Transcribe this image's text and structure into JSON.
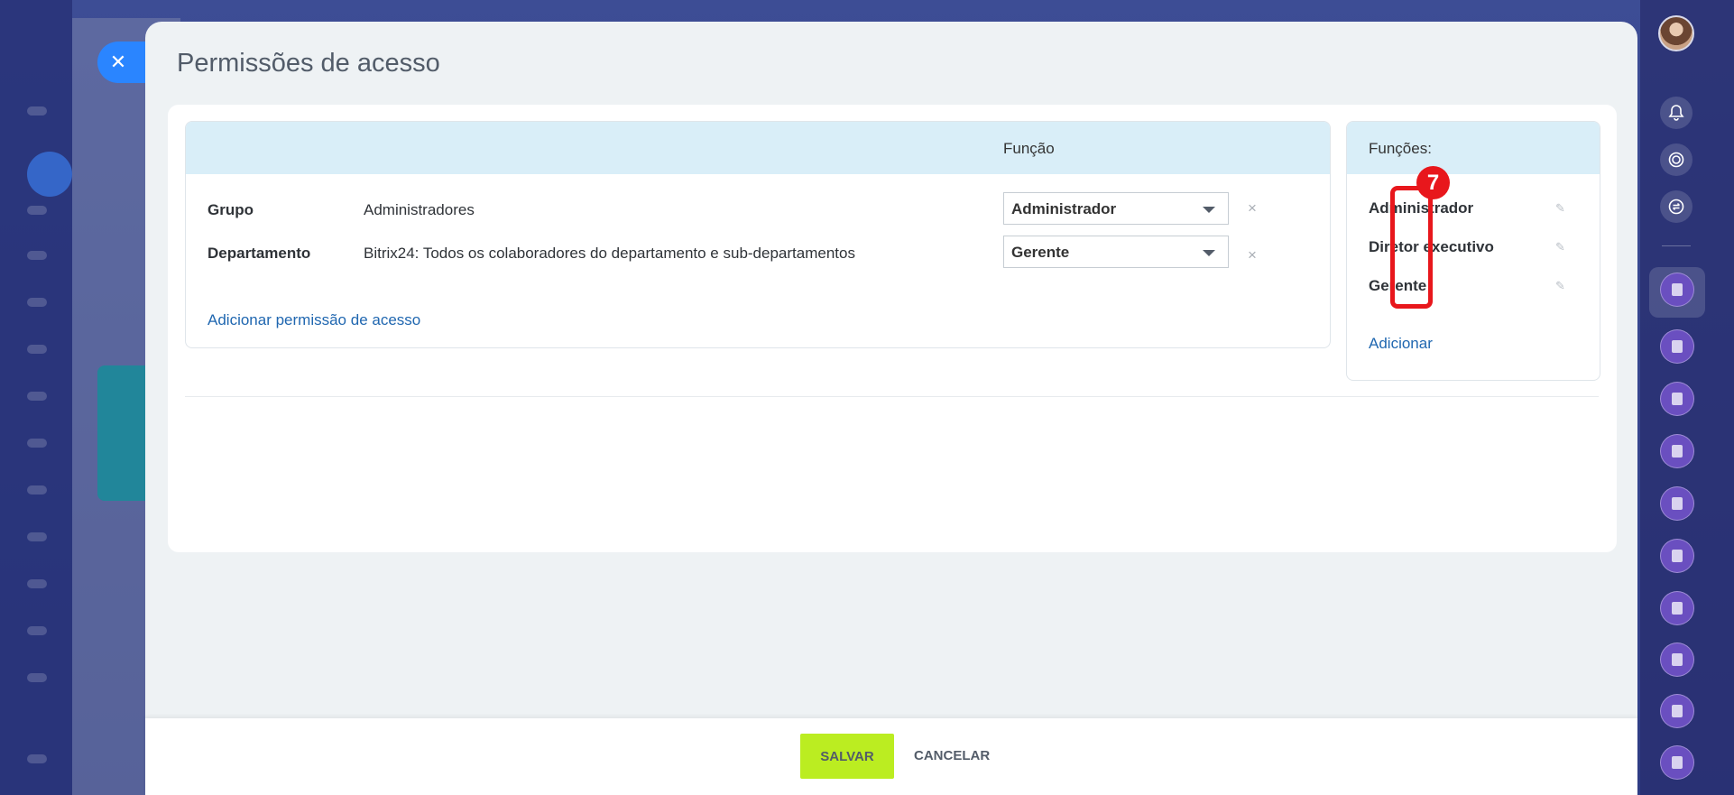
{
  "slider": {
    "title": "Permissões de acesso"
  },
  "permissions": {
    "column_header": "Função",
    "rows": [
      {
        "type": "Grupo",
        "name": "Administradores",
        "role": "Administrador"
      },
      {
        "type": "Departamento",
        "name": "Bitrix24: Todos os colaboradores do departamento e sub-departamentos",
        "role": "Gerente"
      }
    ],
    "delete_symbol": "×",
    "add_link": "Adicionar permissão de acesso"
  },
  "roles": {
    "header": "Funções:",
    "items": [
      "Administrador",
      "Diretor executivo",
      "Gerente"
    ],
    "add_link": "Adicionar"
  },
  "annotation": {
    "step_number": "7",
    "color": "#e8171c"
  },
  "footer": {
    "save_label": "SALVAR",
    "cancel_label": "CANCELAR"
  },
  "colors": {
    "save_button": "#bbed21",
    "header_bg": "#d9eef8",
    "link": "#2067b0"
  }
}
